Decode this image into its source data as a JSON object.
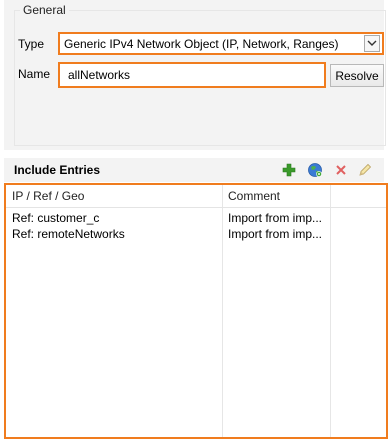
{
  "general": {
    "legend": "General",
    "type_label": "Type",
    "type_value": "Generic IPv4 Network Object (IP, Network, Ranges)",
    "name_label": "Name",
    "name_value": "allNetworks",
    "resolve_label": "Resolve"
  },
  "include": {
    "title": "Include Entries",
    "columns": [
      "IP / Ref / Geo",
      "Comment"
    ],
    "rows": [
      {
        "ref": "Ref: customer_c",
        "comment": "Import from imp..."
      },
      {
        "ref": "Ref: remoteNetworks",
        "comment": "Import from imp..."
      }
    ]
  },
  "toolbar": {
    "add_icon": "plus-icon",
    "globe_icon": "globe-icon",
    "delete_icon": "close-icon",
    "edit_icon": "pencil-icon"
  },
  "colors": {
    "highlight": "#f07c1e",
    "add_green": "#3a9a2a",
    "delete_red": "#e06060"
  }
}
